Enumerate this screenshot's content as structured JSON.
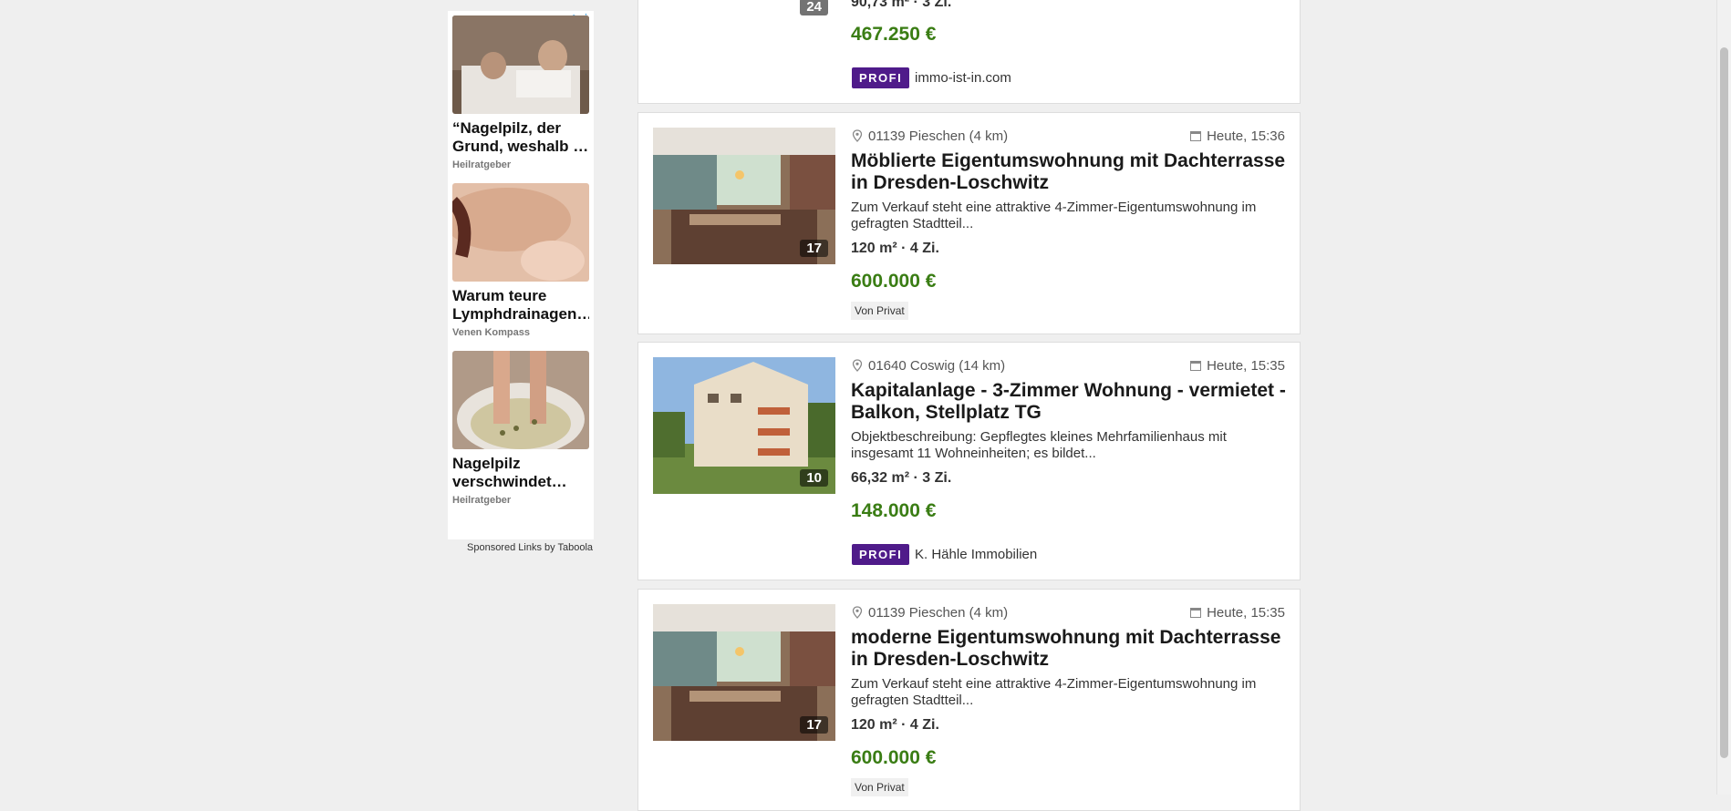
{
  "ad": {
    "badge": "▷⋮",
    "items": [
      {
        "title": "“Nagelpilz, der Grund, weshalb …",
        "source": "Heilratgeber"
      },
      {
        "title": "Warum teure Lymphdrainagen…",
        "source": "Venen Kompass"
      },
      {
        "title": "Nagelpilz verschwindet…",
        "source": "Heilratgeber"
      }
    ],
    "sponsored": "Sponsored Links by Taboola"
  },
  "listings": [
    {
      "img_count": "24",
      "meta": "90,73 m² · 3 Zi.",
      "price": "467.250 €",
      "badge": "PROFI",
      "seller": "immo-ist-in.com"
    },
    {
      "location": "01139 Pieschen (4 km)",
      "date": "Heute, 15:36",
      "title": "Möblierte Eigentumswohnung mit Dachterrasse in Dresden-Loschwitz",
      "description": "Zum Verkauf steht eine attraktive 4-Zimmer-Eigentumswohnung im gefragten Stadtteil...",
      "meta": "120 m² · 4 Zi.",
      "price": "600.000 €",
      "seller_type": "Von Privat",
      "img_count": "17"
    },
    {
      "location": "01640 Coswig (14 km)",
      "date": "Heute, 15:35",
      "title": "Kapitalanlage - 3-Zimmer Wohnung - vermietet - Balkon, Stellplatz TG",
      "description": "Objektbeschreibung: Gepflegtes kleines Mehrfamilienhaus mit insgesamt 11 Wohneinheiten; es bildet...",
      "meta": "66,32 m² · 3 Zi.",
      "price": "148.000 €",
      "badge": "PROFI",
      "seller": "K. Hähle Immobilien",
      "img_count": "10"
    },
    {
      "location": "01139 Pieschen (4 km)",
      "date": "Heute, 15:35",
      "title": "moderne Eigentumswohnung mit Dachterrasse in Dresden-Loschwitz",
      "description": "Zum Verkauf steht eine attraktive 4-Zimmer-Eigentumswohnung im gefragten Stadtteil...",
      "meta": "120 m² · 4 Zi.",
      "price": "600.000 €",
      "seller_type": "Von Privat",
      "img_count": "17"
    }
  ],
  "colors": {
    "price": "#3a7d14",
    "profi_badge": "#4f1b8a",
    "background": "#efefef"
  }
}
